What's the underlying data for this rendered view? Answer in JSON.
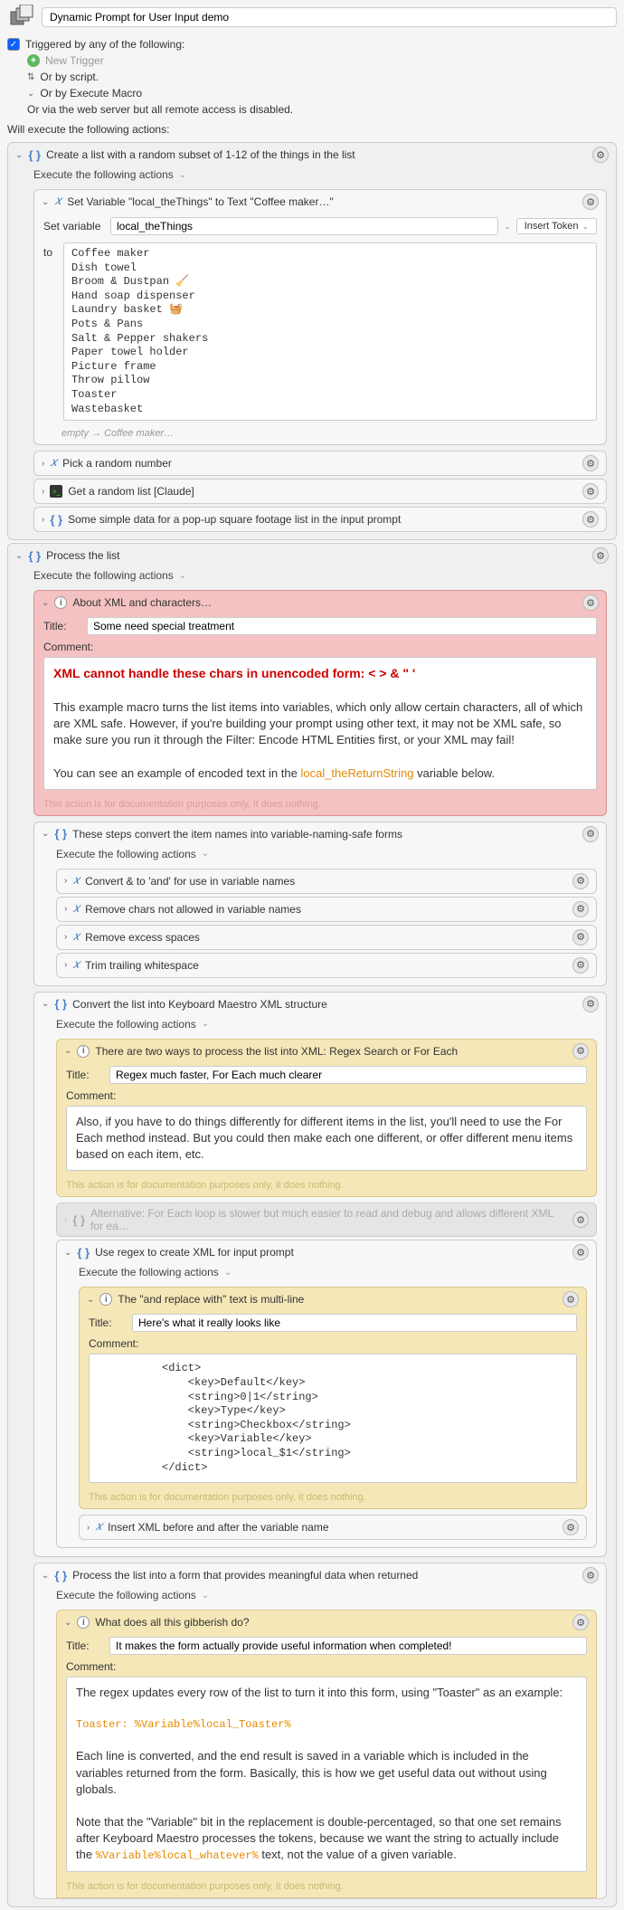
{
  "header": {
    "title": "Dynamic Prompt for User Input demo"
  },
  "triggers": {
    "heading": "Triggered by any of the following:",
    "new_trigger": "New Trigger",
    "by_script": "Or by script.",
    "by_macro": "Or by Execute Macro",
    "web_server": "Or via the web server but all remote access is disabled."
  },
  "execute_label": "Will execute the following actions:",
  "group1": {
    "title": "Create a list with a random subset of 1-12 of the things in the list",
    "exec_label": "Execute the following actions",
    "setvar": {
      "title": "Set Variable \"local_theThings\" to Text \"Coffee maker…\"",
      "label": "Set variable",
      "var_name": "local_theThings",
      "insert_token": "Insert Token",
      "to_label": "to",
      "value": "Coffee maker\nDish towel\nBroom & Dustpan 🧹\nHand soap dispenser\nLaundry basket 🧺\nPots & Pans\nSalt & Pepper shakers\nPaper towel holder\nPicture frame\nThrow pillow\nToaster\nWastebasket",
      "empty_hint": "empty → Coffee maker…"
    },
    "pick_random": "Pick a random number",
    "get_random_list": "Get a random list [Claude]",
    "simple_data": "Some simple data for a pop-up square footage list in the input prompt"
  },
  "group2": {
    "title": "Process the list",
    "exec_label": "Execute the following actions",
    "xml_note": {
      "header": "About XML and characters…",
      "title_label": "Title:",
      "title_value": "Some need special treatment",
      "comment_label": "Comment:",
      "red_line": "XML cannot handle these chars in unencoded form: < > & \" '",
      "p1": "This example macro turns the list items into variables, which only allow certain characters, all of which are XML safe. However, if you're building your prompt using other text, it may not be XML safe, so make sure you run it through the Filter: Encode HTML Entities first, or your XML may fail!",
      "p2a": "You can see an example of encoded text in the ",
      "p2b": "local_theReturnString",
      "p2c": " variable below.",
      "doc_note": "This action is for documentation purposes only, it does nothing."
    },
    "steps_convert": {
      "title": "These steps convert the item names into variable-naming-safe forms",
      "exec_label": "Execute the following actions",
      "a1": "Convert & to 'and' for use in variable names",
      "a2": "Remove chars not allowed in variable names",
      "a3": "Remove excess spaces",
      "a4": "Trim trailing whitespace"
    },
    "convert_xml": {
      "title": "Convert the list into Keyboard Maestro XML structure",
      "exec_label": "Execute the following actions",
      "two_ways": {
        "header": "There are two ways to process the list into XML: Regex Search or For Each",
        "title_label": "Title:",
        "title_value": "Regex much faster, For Each much clearer",
        "comment_label": "Comment:",
        "body": "Also, if you have to do things differently for different items in the list, you'll need to use the For Each method instead. But you could then make each one different, or offer different menu items based on each item, etc.",
        "doc_note": "This action is for documentation purposes only, it does nothing."
      },
      "alternative": "Alternative: For Each loop is slower but much easier to read and debug and allows different XML for ea…",
      "use_regex": {
        "title": "Use regex to create XML for input prompt",
        "exec_label": "Execute the following actions",
        "multiline": {
          "header": "The \"and replace with\" text is multi-line",
          "title_label": "Title:",
          "title_value": "Here's what it really looks like",
          "comment_label": "Comment:",
          "code": "<dict>\n    <key>Default</key>\n    <string>0|1</string>\n    <key>Type</key>\n    <string>Checkbox</string>\n    <key>Variable</key>\n    <string>local_$1</string>\n</dict>",
          "doc_note": "This action is for documentation purposes only, it does nothing."
        },
        "insert_xml": "Insert XML before and after the variable name"
      }
    },
    "process_form": {
      "title": "Process the list into a form that provides meaningful data when returned",
      "exec_label": "Execute the following actions",
      "gibberish": {
        "header": "What does all this gibberish do?",
        "title_label": "Title:",
        "title_value": "It makes the form actually provide useful information when completed!",
        "comment_label": "Comment:",
        "p1": "The regex updates every row of the list to turn it into this form, using \"Toaster\" as an example:",
        "code1": "Toaster: %Variable%local_Toaster%",
        "p2": "Each line is converted, and the end result is saved in a variable which is included in the variables returned from the form. Basically, this is how we get useful data out without using globals.",
        "p3a": "Note that the \"Variable\" bit in the replacement is double-percentaged, so that one set remains after Keyboard Maestro processes the tokens, because we want the string to actually include the ",
        "p3b": "%Variable%local_whatever%",
        "p3c": " text, not the value of a given variable.",
        "doc_note": "This action is for documentation purposes only, it does nothing."
      }
    }
  }
}
